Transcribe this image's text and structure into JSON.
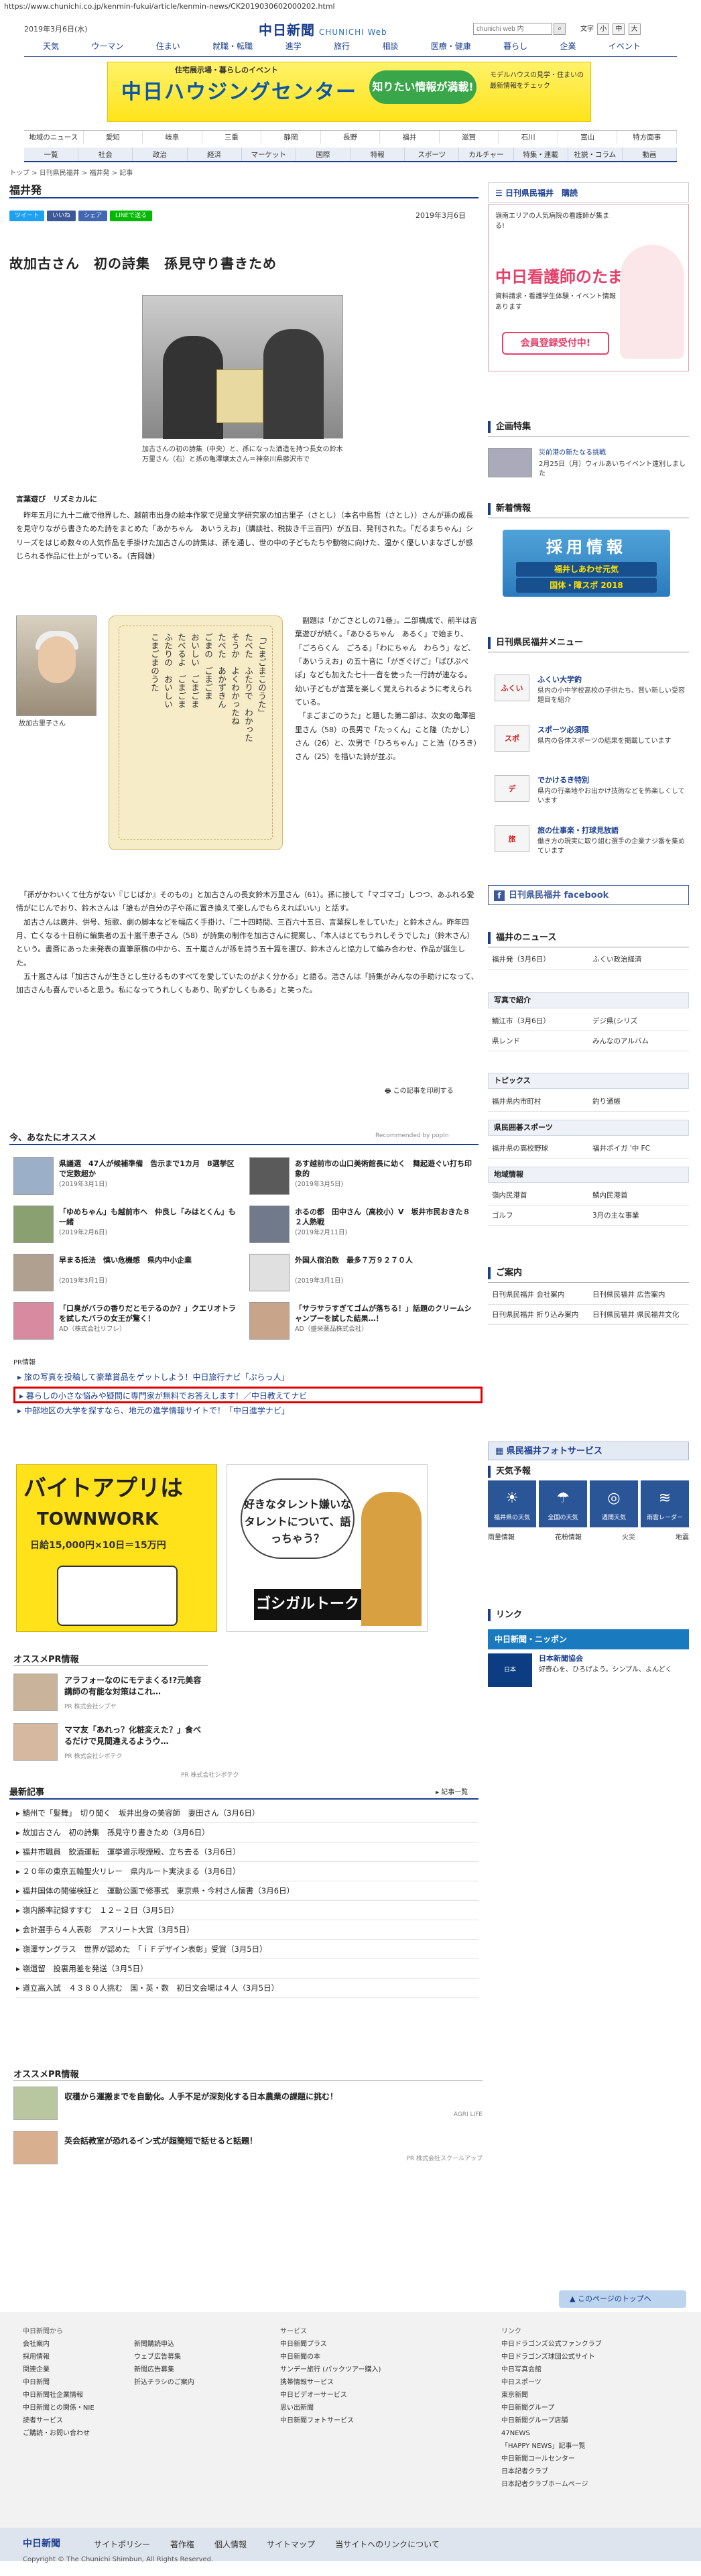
{
  "url": "https://www.chunichi.co.jp/kenmin-fukui/article/kenmin-news/CK2019030602000202.html",
  "header": {
    "date": "2019年3月6日(水)",
    "logo": "中日新聞",
    "logo_sub": "CHUNICHI Web",
    "search_placeholder": "chunichi web 内",
    "font_label": "文字",
    "font_small": "小",
    "font_mid": "中",
    "font_large": "大",
    "categories": [
      "天気",
      "ウーマン",
      "住まい",
      "就職・転職",
      "進学",
      "旅行",
      "相談",
      "医療・健康",
      "暮らし",
      "企業",
      "イベント"
    ]
  },
  "top_banner": {
    "sub": "住宅展示場・暮らしのイベント",
    "main": "中日ハウジングセンター",
    "bubble": "知りたい情報が満載!",
    "right": "モデルハウスの見学・住まいの最新情報をチェック"
  },
  "region_nav": [
    "地域のニュース",
    "愛知",
    "岐阜",
    "三重",
    "静岡",
    "長野",
    "福井",
    "滋賀",
    "石川",
    "富山",
    "特方面事"
  ],
  "sub_nav": [
    "一覧",
    "社会",
    "政治",
    "経済",
    "マーケット",
    "国際",
    "特報",
    "スポーツ",
    "カルチャー",
    "特集・連載",
    "社説・コラム",
    "動画"
  ],
  "breadcrumb": "トップ > 日刊県民福井 > 福井発 > 記事",
  "section_title": "福井発",
  "social": {
    "tweet": "ツイート",
    "like": "いいね",
    "share": "シェア",
    "line": "LINEで送る"
  },
  "article": {
    "date": "2019年3月6日",
    "headline": "故加古さん　初の詩集　孫見守り書きため",
    "photo_caption": "加古さんの初の詩集（中央）と、孫になった酒造を持つ長女の鈴木万里さん（右）と孫の亀澤壌太さん＝神奈川県藤沢市で",
    "lead_heading": "言葉遊び　リズミカルに",
    "para1": "　昨年五月に九十二歳で他界した、越前市出身の絵本作家で児童文学研究家の加古里子（さとし）（本名中島哲（さとし））さんが孫の成長を見守りながら書きためた詩をまとめた「あかちゃん　あいうえお」（講談社、税抜き千三百円）が五日、発刊された。「だるまちゃん」シリーズをはじめ数々の人気作品を手掛けた加古さんの詩集は、孫を通し、世の中の子どもたちや動物に向けた、温かく優しいまなざしが感じられる作品に仕上がっている。（吉岡雄）",
    "portrait_caption": "故加古里子さん",
    "poem": "「ごまごまこのうた」\nたべた　ふたりで　わかった\nそうか　よくわかったね\nたべた　あかずきん\nごまの　ごまごま\nおいしい　ごまごま\nたべるよ　ごまごま\nふたりの　おいしい\nこまごまのうた",
    "para2": "　副題は「かごさとしの71番」。二部構成で、前半は言葉遊びが続く。「あひるちゃん　あるく」で始まり、「ごろらくん　ごろる」「わにちゃん　わらう」など、「あいうえお」の五十音に「がぎぐげご」「ぱぴぷぺぽ」なども加えた七十一音を使った一行詩が連なる。幼い子どもが言葉を楽しく覚えられるように考えられている。\n　「まごまごのうた」と題した第二部は、次女の亀澤祖里さん（58）の長男で「たっくん」こと隆（たかし）さん（26）と、次男で「ひろちゃん」こと浩（ひろき）さん（25）を描いた詩が並ぶ。",
    "para3": "　「孫がかわいくて仕方がない『じじばか』そのもの」と加古さんの長女鈴木万里さん（61）。孫に接して「マゴマゴ」しつつ、あふれる愛情がにじんでおり、鈴木さんは「誰もが自分の子や孫に置き換えて楽しんでもらえればいい」と話す。\n　加古さんは廣井、併号、短歌、劇の脚本などを幅広く手掛け、「二十四時間、三百六十五日、言葉探しをしていた」と鈴木さん。昨年四月、亡くなる十日前に編集者の五十嵐千恵子さん（58）が詩集の制作を加古さんに提案し、「本人はとてもうれしそうでした」（鈴木さん）という。書斎にあった未発表の直筆原稿の中から、五十嵐さんが孫を詩う五十篇を選び、鈴木さんと協力して編み合わせ、作品が誕生した。\n　五十嵐さんは「加古さんが生きとし生けるものすべてを愛していたのがよく分かる」と語る。浩さんは「詩集がみんなの手助けになって、加古さんも喜んでいると思う。私になってうれしくもあり、恥ずかしくもある」と笑った。",
    "print_link": "この記事を印刷する"
  },
  "recommend": {
    "title": "今、あなたにオススメ",
    "by": "Recommended by popIn",
    "items": [
      {
        "title": "県議選　47人が候補準備　告示まで1カ月　8選挙区で定数超か",
        "date": "(2019年3月1日)"
      },
      {
        "title": "あす越前市の山口美術館長に幼く　舞起遊ぐい打ち印象的",
        "date": "(2019年3月5日)"
      },
      {
        "title": "「ゆめちゃん」も越前市へ　仲良し「みはとくん」も一緒",
        "date": "(2019年2月6日)"
      },
      {
        "title": "ホるの都　田中さん（高校小）V　坂井市民おきた８２人熱戦",
        "date": "(2019年2月11日)"
      },
      {
        "title": "早まる抵法　慎い危機感　県内中小企業",
        "date": "(2019年3月1日)"
      },
      {
        "title": "外国人宿泊数　最多７万９２７０人",
        "date": "(2019年3月1日)"
      },
      {
        "title": "「口臭がバラの香りだとモテるのか？」クエリオトラを試したバラの女王が驚く！",
        "date": "AD（株式会社リフレ）"
      },
      {
        "title": "「サラサラすぎてゴムが落ちる！」話題のクリームシャンプーを試した結果…！",
        "date": "AD（盛栄薬品株式会社）"
      }
    ]
  },
  "pr": {
    "label": "PR情報",
    "rows": [
      "旅の写真を投稿して豪華賞品をゲットしよう！中日旅行ナビ「ぷらっ人」",
      "暮らしの小さな悩みや疑問に専門家が無料でお答えします！／中日教えてナビ",
      "中部地区の大学を探すなら、地元の進学情報サイトで！「中日進学ナビ」"
    ]
  },
  "banner_left": {
    "t1": "バイトアプリは",
    "t2": "TOWNWORK",
    "t3": "日給15,000円×10日＝15万円"
  },
  "banner_right": {
    "t1": "好きなタレント嫌いなタレントについて、語っちゃう？",
    "t2": "ゴシガルトーク"
  },
  "ospr": {
    "title": "オススメPR情報",
    "items": [
      {
        "title": "アラフォーなのにモテまくる!?元美容講師の有能な対策はこれ…",
        "sponsor": "PR 株式会社シブヤ"
      },
      {
        "title": "ママ友「あれっ？化粧変えた？」食べるだけで見間違えるようウ…",
        "sponsor": "PR 株式会社シボテク"
      }
    ],
    "mark": "PR 株式会社シボテク"
  },
  "latest": {
    "title": "最新記事",
    "list_link": "記事一覧",
    "rows": [
      "鯖州で「髪舞」　切り聞く　坂井出身の美容師　妻田さん（3月6日）",
      "故加古さん　初の詩集　孫見守り書きため（3月6日）",
      "福井市職員　飲酒運転　運挙道示喫煙殿、立ち去る（3月6日）",
      "２０年の東京五輪聖火リレー　県内ルート実決まる（3月6日）",
      "福井国体の開催検証と　運動公園で修事式　東京県・今村さん懐書（3月6日）",
      "嶺内勝率記録すすむ　１２－２日（3月5日）",
      "会計選手ら４人表彰　アスリート大賞（3月5日）",
      "嶺澤サングラス　世界が認めた　「ｉＦデザイン表彰」受賞（3月5日）",
      "嶺還留　投裏用差を発送（3月5日）",
      "道立高入試　４３８０人挑む　国・英・数　初日文会場は４人（3月5日）"
    ]
  },
  "ospr2": {
    "title": "オススメPR情報",
    "items": [
      {
        "title": "収穫から運搬までを自動化。人手不足が深刻化する日本農業の課題に挑む！",
        "sponsor": "AGRI LIFE"
      },
      {
        "title": "英会話教室が恐れるイン式が超簡短で話せると話題！",
        "sponsor": "PR 株式会社スクールアップ"
      }
    ]
  },
  "sidebar": {
    "ad_head": "日刊県民福井　購読",
    "ad_body": {
      "a1": "嶺南エリアの人気病院の看護師が集まる!",
      "a2": "中日看護師のたまご",
      "a3": "資料請求・看護学生体験・イベント情報 あります",
      "a4": "会員登録受付中!"
    },
    "kikaku_title": "企画特集",
    "kikaku_item": {
      "t1": "災前港の新たなる挑戦",
      "t2": "2月25日（月）ウィルあいちイベント遠別しました"
    },
    "recruit_title": "新着情報",
    "recruit": {
      "r1": "採用情報",
      "r2": "福井しあわせ元気",
      "r3": "国体・障スポ 2018"
    },
    "menu_title": "日刊県民福井メニュー",
    "menu": [
      {
        "icon": "ふくい",
        "title": "ふくい大学釣",
        "desc": "県内の小中学校高校の子供たち、賢い新しい受容題目を紹介"
      },
      {
        "icon": "スポ",
        "title": "スポーツ必須限",
        "desc": "県内の各体スポーツの結果を掲載しています"
      },
      {
        "icon": "デ",
        "title": "でかけるき特別",
        "desc": "県内の行楽地やお出かけ技術などを怖楽しくしています"
      },
      {
        "icon": "旅",
        "title": "旅の仕事楽・打球見放語",
        "desc": "働き方の現実に取り組む選手の企業ナジ番を集めています"
      }
    ],
    "facebook": "日刊県民福井 facebook",
    "news_title": "福井のニュース",
    "news": [
      "福井発（3月6日）",
      "ふくい政治経済",
      "写真で紹介",
      "鯖江市（3月6日）",
      "デジ県(シリズ",
      "県レンド",
      "みんなのアルバム"
    ],
    "topics_title": "トピックス",
    "topics": [
      "福井県内市町村",
      "釣り通帳"
    ],
    "sports_title": "県民囲碁スポーツ",
    "sports": [
      "福井県の高校野球",
      "福井ポイガ '中 FC"
    ],
    "region_title": "地域情報",
    "region": [
      "嶺内民港首",
      "鯖内民港首",
      "ゴルフ",
      "3月の主な事業"
    ],
    "annai_title": "ご案内",
    "annai": [
      "日刊県民福井",
      "会社案内",
      "日刊県民福井",
      "広告案内",
      "日刊県民福井",
      "折り込み案内",
      "日刊県民福井",
      "県民福井文化"
    ],
    "photo_service": "県民福井フォトサービス",
    "weather_title": "天気予報",
    "weather": [
      {
        "sym": "☀",
        "label": "福井県の天気"
      },
      {
        "sym": "☂",
        "label": "全国の天気"
      },
      {
        "sym": "◎",
        "label": "週間天気"
      },
      {
        "sym": "≋",
        "label": "雨雲レーダー"
      }
    ],
    "weather_links": [
      "雨量情報",
      "花粉情報",
      "火災",
      "地震"
    ],
    "link_title": "リンク",
    "link_banner": "中日新聞・ニッポン",
    "link_item": {
      "icon": "日本",
      "t1": "日本新聞協会",
      "t2": "好奇心を、ひろげよう。シンプル、よんどく"
    }
  },
  "pagetop": "このページのトップへ",
  "footer": {
    "col1": {
      "head": "中日新聞から",
      "items": [
        "会社案内",
        "採用情報",
        "関連企業",
        "中日新聞",
        "中日新聞社企業情報",
        "中日新聞との関係・NIE",
        "読者サービス",
        "ご購読・お問い合わせ"
      ]
    },
    "col2": {
      "head": "",
      "items": [
        "新聞購読申込",
        "ウェブ広告募集",
        "新聞広告募集",
        "折込チラシのご案内"
      ]
    },
    "col3": {
      "head": "サービス",
      "items": [
        "中日新聞プラス",
        "中日新聞の本",
        "サンデー旅行 (パックツアー購入)",
        "携帯情報サービス",
        "中日ビデオーサービス",
        "思い出新聞",
        "中日新聞フォトサービス"
      ]
    },
    "col4": {
      "head": "リンク",
      "items": [
        "中日ドラゴンズ公式ファンクラブ",
        "中日ドラゴンズ球団公式サイト",
        "中日写真会館",
        "中日スポーツ",
        "東京新聞",
        "中日新聞グループ",
        "中日新聞グループ店舗",
        "47NEWS",
        "「HAPPY NEWS」記事一覧",
        "中日新聞コールセンター",
        "日本記者クラブ",
        "日本記者クラブホームページ"
      ]
    }
  },
  "bottom": {
    "logo": "中日新聞",
    "links": [
      "サイトポリシー",
      "著作権",
      "個人情報",
      "サイトマップ",
      "当サイトへのリンクについて"
    ],
    "copyright": "Copyright © The Chunichi Shimbun, All Rights Reserved."
  }
}
